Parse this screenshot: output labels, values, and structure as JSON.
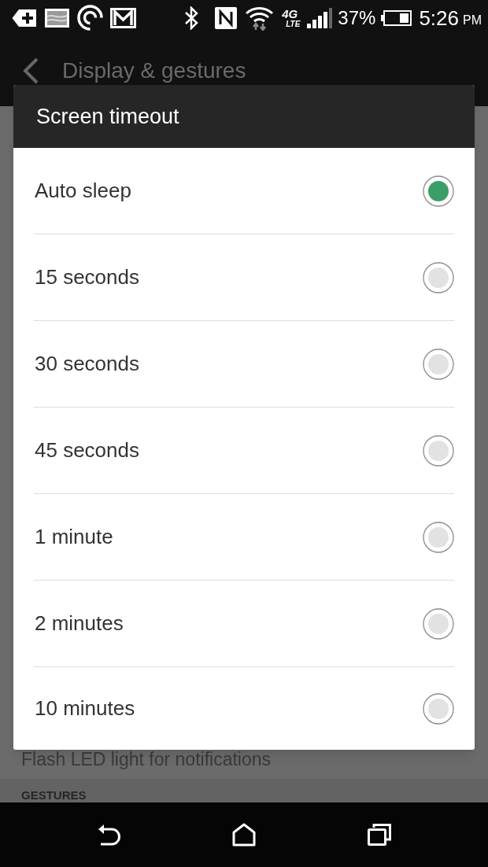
{
  "status_bar": {
    "network": {
      "generation": "4G",
      "technology": "LTE"
    },
    "battery": "37%",
    "time": "5:26",
    "time_period": "PM"
  },
  "app_bar": {
    "title": "Display & gestures"
  },
  "settings_list": [
    {
      "kind": "item",
      "label": "Flash LED light for notifications"
    },
    {
      "kind": "section",
      "label": "GESTURES"
    }
  ],
  "dialog": {
    "title": "Screen timeout",
    "options": [
      {
        "label": "Auto sleep",
        "selected": true
      },
      {
        "label": "15 seconds",
        "selected": false
      },
      {
        "label": "30 seconds",
        "selected": false
      },
      {
        "label": "45 seconds",
        "selected": false
      },
      {
        "label": "1 minute",
        "selected": false
      },
      {
        "label": "2 minutes",
        "selected": false
      },
      {
        "label": "10 minutes",
        "selected": false
      }
    ]
  }
}
